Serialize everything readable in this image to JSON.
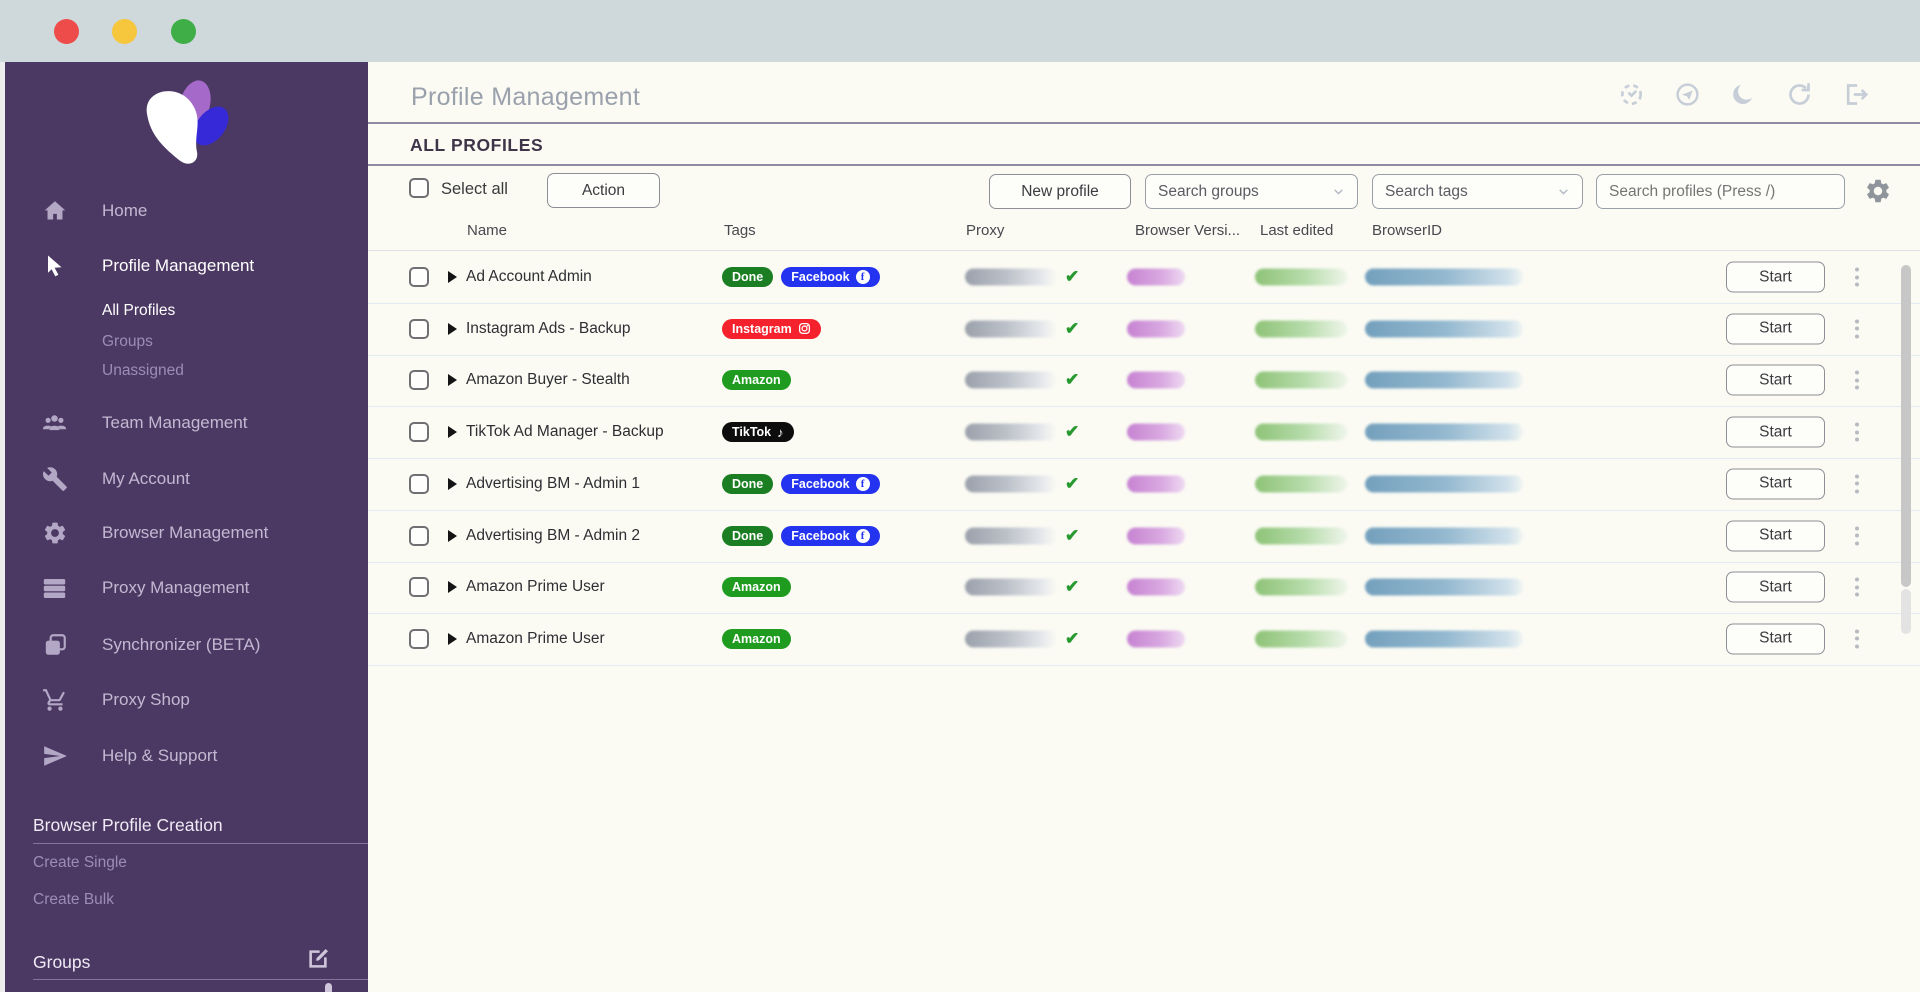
{
  "titlebar": {
    "buttons": [
      "close",
      "minimize",
      "maximize"
    ]
  },
  "sidebar": {
    "logo": "multilogin-flower-logo",
    "items": [
      {
        "label": "Home",
        "icon": "home-icon",
        "active": false
      },
      {
        "label": "Profile Management",
        "icon": "cursor-icon",
        "active": true
      },
      {
        "label": "Team Management",
        "icon": "team-icon",
        "active": false
      },
      {
        "label": "My Account",
        "icon": "wrench-icon",
        "active": false
      },
      {
        "label": "Browser Management",
        "icon": "gear-icon",
        "active": false
      },
      {
        "label": "Proxy Management",
        "icon": "server-icon",
        "active": false
      },
      {
        "label": "Synchronizer (BETA)",
        "icon": "layers-icon",
        "active": false
      },
      {
        "label": "Proxy Shop",
        "icon": "cart-icon",
        "active": false
      },
      {
        "label": "Help & Support",
        "icon": "send-icon",
        "active": false
      }
    ],
    "profile_sub_items": [
      {
        "label": "All Profiles",
        "active": true
      },
      {
        "label": "Groups",
        "active": false
      },
      {
        "label": "Unassigned",
        "active": false
      }
    ],
    "creation_section": {
      "title": "Browser Profile Creation",
      "items": [
        "Create Single",
        "Create Bulk"
      ]
    },
    "groups_section": {
      "title": "Groups",
      "edit_icon": "edit-icon"
    }
  },
  "header": {
    "title": "Profile Management",
    "icons": [
      "auto-update-icon",
      "telegram-icon",
      "dark-mode-moon-icon",
      "refresh-icon",
      "logout-icon"
    ]
  },
  "subheader": {
    "title": "ALL PROFILES"
  },
  "toolbar": {
    "select_all_label": "Select all",
    "action_label": "Action",
    "new_profile_label": "New profile",
    "search_groups_placeholder": "Search groups",
    "search_tags_placeholder": "Search tags",
    "search_profiles_placeholder": "Search profiles (Press /)",
    "settings_icon": "gear-icon"
  },
  "table": {
    "columns": [
      "Name",
      "Tags",
      "Proxy",
      "Browser Versi...",
      "Last edited",
      "BrowserID"
    ],
    "start_label": "Start",
    "rows": [
      {
        "name": "Ad Account Admin",
        "tags": [
          {
            "label": "Done",
            "type": "done"
          },
          {
            "label": "Facebook",
            "type": "facebook"
          }
        ]
      },
      {
        "name": "Instagram Ads -  Backup",
        "tags": [
          {
            "label": "Instagram",
            "type": "instagram"
          }
        ]
      },
      {
        "name": "Amazon Buyer - Stealth",
        "tags": [
          {
            "label": "Amazon",
            "type": "amazon"
          }
        ]
      },
      {
        "name": "TikTok Ad Manager  - Backup",
        "tags": [
          {
            "label": "TikTok",
            "type": "tiktok"
          }
        ]
      },
      {
        "name": "Advertising BM - Admin 1",
        "tags": [
          {
            "label": "Done",
            "type": "done"
          },
          {
            "label": "Facebook",
            "type": "facebook"
          }
        ]
      },
      {
        "name": "Advertising BM - Admin 2",
        "tags": [
          {
            "label": "Done",
            "type": "done"
          },
          {
            "label": "Facebook",
            "type": "facebook"
          }
        ]
      },
      {
        "name": "Amazon Prime User",
        "tags": [
          {
            "label": "Amazon",
            "type": "amazon"
          }
        ]
      },
      {
        "name": "Amazon Prime User",
        "tags": [
          {
            "label": "Amazon",
            "type": "amazon"
          }
        ]
      }
    ]
  },
  "colors": {
    "sidebar_bg": "#4c3963",
    "tag_done": "#1b7e22",
    "tag_amazon": "#1f9b1f",
    "tag_facebook": "#2433f0",
    "tag_instagram": "#f5212d",
    "tag_tiktok": "#0d0d0d",
    "check_green": "#27992f"
  }
}
